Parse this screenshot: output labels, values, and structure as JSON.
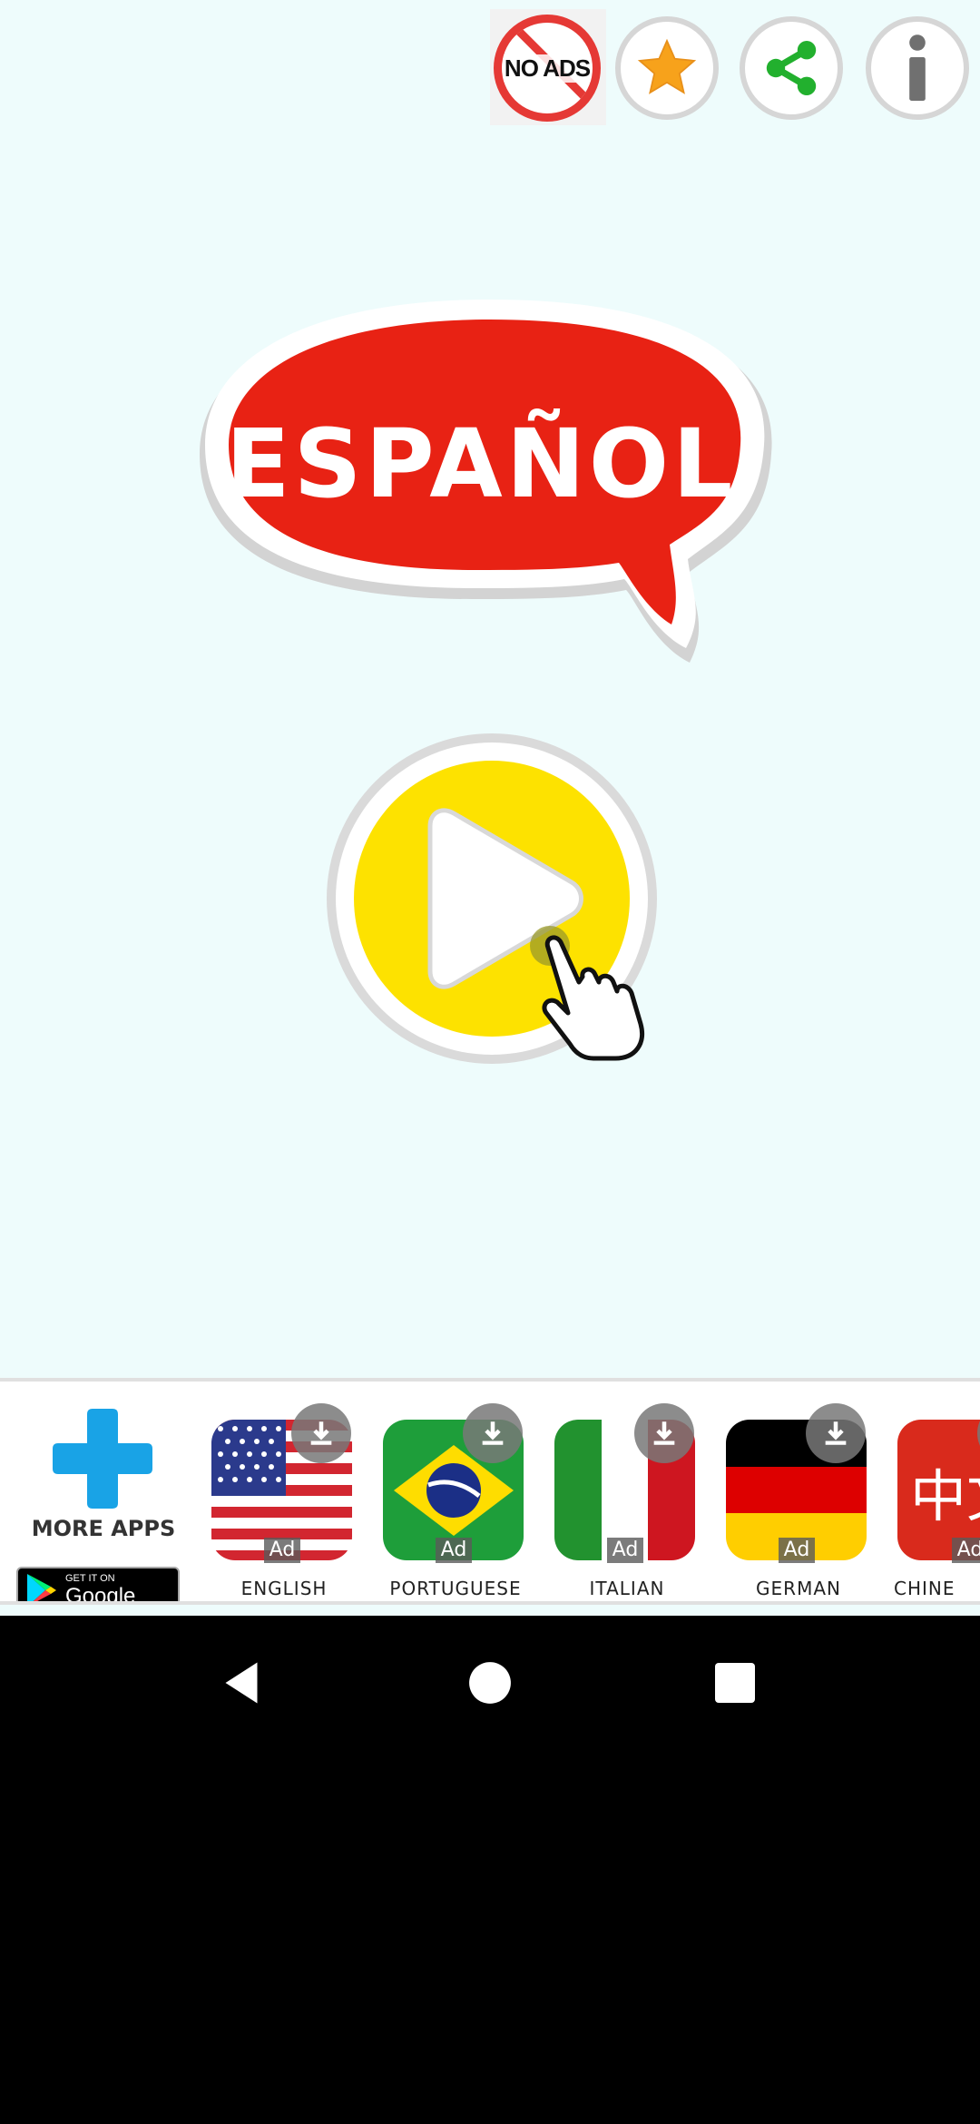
{
  "toolbar": {
    "no_ads_label": "NO ADS",
    "rate_icon": "star-icon",
    "share_icon": "share-icon",
    "info_icon": "info-icon"
  },
  "title": {
    "text": "ESPAÑOL",
    "bubble_color": "#e82214"
  },
  "play": {
    "icon": "play-icon",
    "color": "#fde200"
  },
  "ad_strip": {
    "more_apps_label": "MORE APPS",
    "google_play_small": "GET IT ON",
    "google_play_big": "Google Play",
    "apps": [
      {
        "label": "ENGLISH",
        "ad": "Ad"
      },
      {
        "label": "PORTUGUESE",
        "ad": "Ad"
      },
      {
        "label": "ITALIAN",
        "ad": "Ad"
      },
      {
        "label": "GERMAN",
        "ad": "Ad"
      },
      {
        "label": "CHINE",
        "ad": "Ad",
        "flag_text": "中文"
      }
    ]
  },
  "navbar": {
    "back_icon": "back-icon",
    "home_icon": "home-icon",
    "recents_icon": "recents-icon"
  }
}
